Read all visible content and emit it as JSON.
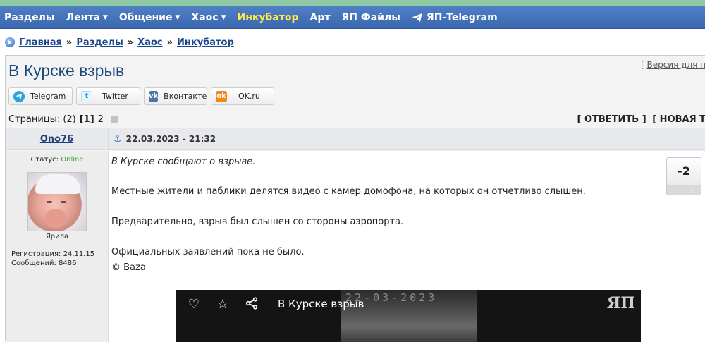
{
  "nav": {
    "items": [
      {
        "label": "Разделы",
        "caret": false,
        "highlight": false
      },
      {
        "label": "Лента",
        "caret": true,
        "highlight": false
      },
      {
        "label": "Общение",
        "caret": true,
        "highlight": false
      },
      {
        "label": "Хаос",
        "caret": true,
        "highlight": false
      },
      {
        "label": "Инкубатор",
        "caret": false,
        "highlight": true
      },
      {
        "label": "Арт",
        "caret": false,
        "highlight": false
      },
      {
        "label": "ЯП Файлы",
        "caret": false,
        "highlight": false
      },
      {
        "label": "ЯП-Telegram",
        "caret": false,
        "highlight": false,
        "icon": "telegram-icon"
      }
    ],
    "caret_glyph": "▼"
  },
  "breadcrumb": {
    "items": [
      "Главная",
      "Разделы",
      "Хаос",
      "Инкубатор"
    ],
    "separator": "»"
  },
  "topic": {
    "title": "В Курске взрыв",
    "print_link": "Версия для п",
    "print_bracket_open": "[ "
  },
  "share": {
    "telegram": "Telegram",
    "twitter": "Twitter",
    "vkontakte": "Вконтакте",
    "ok": "OK.ru"
  },
  "pager": {
    "label": "Страницы:",
    "total": "(2)",
    "current": "[1]",
    "next": "2",
    "reply": "[ ОТВЕТИТЬ ]",
    "new_topic": "[ НОВАЯ Т"
  },
  "post": {
    "author": "Ono76",
    "date": "22.03.2023 - 21:32",
    "status_label": "Статус:",
    "status_value": "Online",
    "avatar_caption": "Ярила",
    "registration": "Регистрация: 24.11.15",
    "messages": "Сообщений: 8486",
    "lines": [
      "В Курске сообщают о взрыве.",
      "Местные жители и паблики делятся видео с камер домофона, на которых он отчетливо слышен.",
      "Предварительно, взрыв был слышен со стороны аэропорта.",
      "Официальных заявлений пока не было.",
      "© Baza"
    ],
    "rating": "-2",
    "vote_minus": "−",
    "vote_plus": "+",
    "video": {
      "title": "В Курске взрыв",
      "frame_date": "22-03-2023",
      "logo": "ЯП"
    }
  },
  "colors": {
    "nav_bg": "#4375bb",
    "nav_highlight": "#ffe84a",
    "title": "#1c4a7d",
    "link": "#19478a",
    "online": "#3aa63a"
  }
}
